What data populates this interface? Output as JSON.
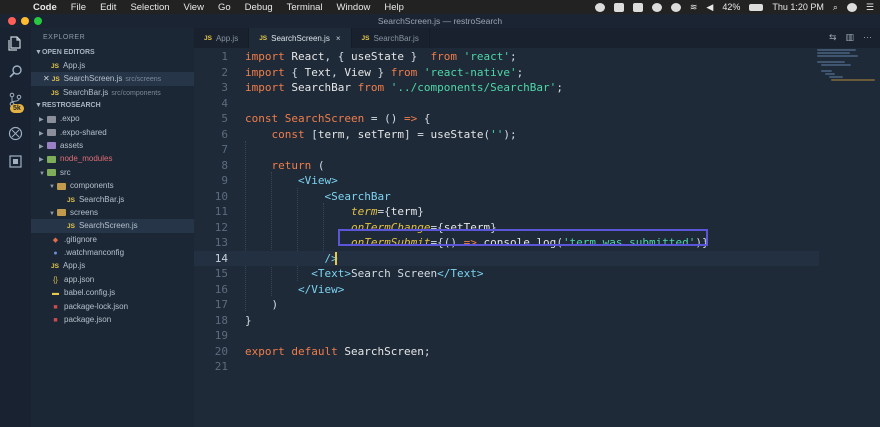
{
  "menubar": {
    "app": "Code",
    "items": [
      "File",
      "Edit",
      "Selection",
      "View",
      "Go",
      "Debug",
      "Terminal",
      "Window",
      "Help"
    ],
    "battery": "42%",
    "time": "Thu 1:20 PM"
  },
  "window": {
    "title": "SearchScreen.js — restroSearch"
  },
  "activity": {
    "badge": "5k"
  },
  "sidebar": {
    "title": "EXPLORER",
    "open_editors_label": "OPEN EDITORS",
    "open_editors": [
      {
        "icon": "JS",
        "name": "App.js",
        "desc": ""
      },
      {
        "icon": "JS",
        "name": "SearchScreen.js",
        "desc": "src/screens"
      },
      {
        "icon": "JS",
        "name": "SearchBar.js",
        "desc": "src/components"
      }
    ],
    "project_label": "RESTROSEARCH",
    "tree": [
      {
        "name": ".expo"
      },
      {
        "name": ".expo-shared"
      },
      {
        "name": "assets"
      },
      {
        "name": "node_modules"
      },
      {
        "name": "src"
      },
      {
        "name": "components"
      },
      {
        "name": "SearchBar.js",
        "icon": "JS"
      },
      {
        "name": "screens"
      },
      {
        "name": "SearchScreen.js",
        "icon": "JS"
      },
      {
        "name": ".gitignore"
      },
      {
        "name": ".watchmanconfig"
      },
      {
        "name": "App.js",
        "icon": "JS"
      },
      {
        "name": "app.json",
        "icon": "{ }"
      },
      {
        "name": "babel.config.js"
      },
      {
        "name": "package-lock.json"
      },
      {
        "name": "package.json"
      }
    ]
  },
  "tabs": [
    {
      "icon": "JS",
      "label": "App.js"
    },
    {
      "icon": "JS",
      "label": "SearchScreen.js",
      "close": "×"
    },
    {
      "icon": "JS",
      "label": "SearchBar.js"
    }
  ],
  "editor": {
    "line_numbers": [
      "1",
      "2",
      "3",
      "4",
      "5",
      "6",
      "7",
      "8",
      "9",
      "10",
      "11",
      "12",
      "13",
      "14",
      "15",
      "16",
      "17",
      "18",
      "19",
      "20",
      "21"
    ],
    "current_line": "14"
  }
}
